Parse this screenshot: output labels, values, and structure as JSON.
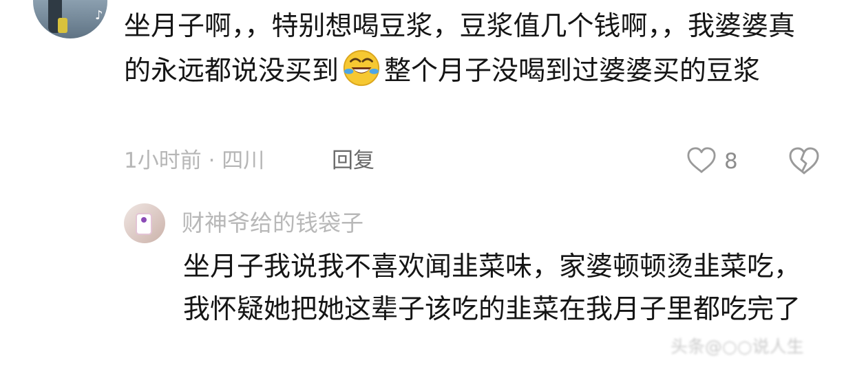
{
  "comment": {
    "text_before_emoji": "坐月子啊，，特别想喝豆浆，豆浆值几个钱啊，，我婆婆真的永远都说没买到",
    "emoji_icon": "rolling-laughing-emoji",
    "text_after_emoji": "整个月子没喝到过婆婆买的豆浆",
    "meta": "1小时前 · 四川",
    "reply_label": "回复",
    "likes": "8"
  },
  "reply": {
    "author": "财神爷给的钱袋子",
    "text": "坐月子我说我不喜欢闻韭菜味，家婆顿顿烫韭菜吃，我怀疑她把她这辈子该吃的韭菜在我月子里都吃完了"
  },
  "watermark": "头条@○○说人生",
  "colors": {
    "text": "#151515",
    "meta": "#b6b6b6",
    "reply_button": "#6a6a6a",
    "icon": "#9a9a9a",
    "emoji_face": "#f6c832"
  }
}
